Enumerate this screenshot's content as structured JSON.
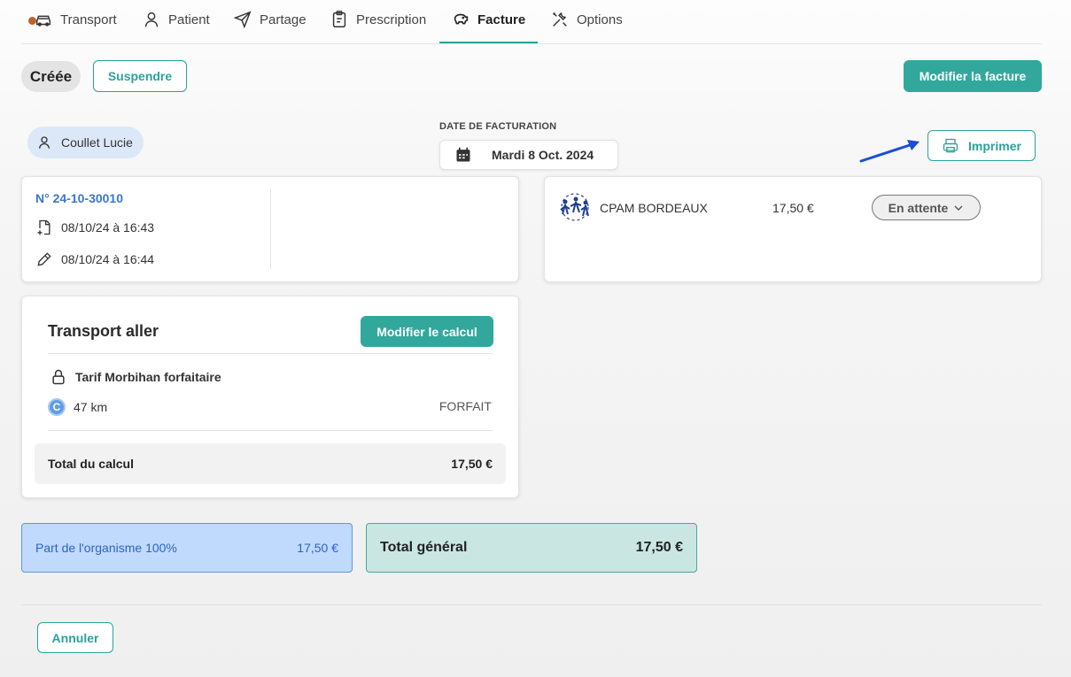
{
  "tabs": [
    {
      "label": "Transport",
      "icon": "car-icon"
    },
    {
      "label": "Patient",
      "icon": "person-icon"
    },
    {
      "label": "Partage",
      "icon": "send-icon"
    },
    {
      "label": "Prescription",
      "icon": "clipboard-icon"
    },
    {
      "label": "Facture",
      "icon": "piggy-bank-icon",
      "active": true
    },
    {
      "label": "Options",
      "icon": "tools-icon"
    }
  ],
  "header": {
    "status": "Créée",
    "suspend_label": "Suspendre",
    "edit_invoice_label": "Modifier la facture"
  },
  "patient": {
    "name": "Coullet Lucie"
  },
  "billing_date": {
    "label": "DATE DE FACTURATION",
    "value": "Mardi 8 Oct. 2024"
  },
  "print_label": "Imprimer",
  "invoice": {
    "number": "N° 24-10-30010",
    "created": "08/10/24 à 16:43",
    "edited": "08/10/24 à 16:44"
  },
  "payer": {
    "name": "CPAM BORDEAUX",
    "amount": "17,50 €",
    "status": "En attente"
  },
  "transport": {
    "title": "Transport aller",
    "edit_calc_label": "Modifier le calcul",
    "tariff": "Tarif Morbihan forfaitaire",
    "badge": "C",
    "distance": "47 km",
    "mode": "FORFAIT",
    "total_label": "Total du calcul",
    "total_value": "17,50 €"
  },
  "summary": {
    "org_label": "Part de l'organisme 100%",
    "org_value": "17,50 €",
    "grand_label": "Total général",
    "grand_value": "17,50 €"
  },
  "cancel_label": "Annuler",
  "colors": {
    "accent": "#2aa39a",
    "link": "#3a76cf",
    "notification": "#c0622f"
  }
}
